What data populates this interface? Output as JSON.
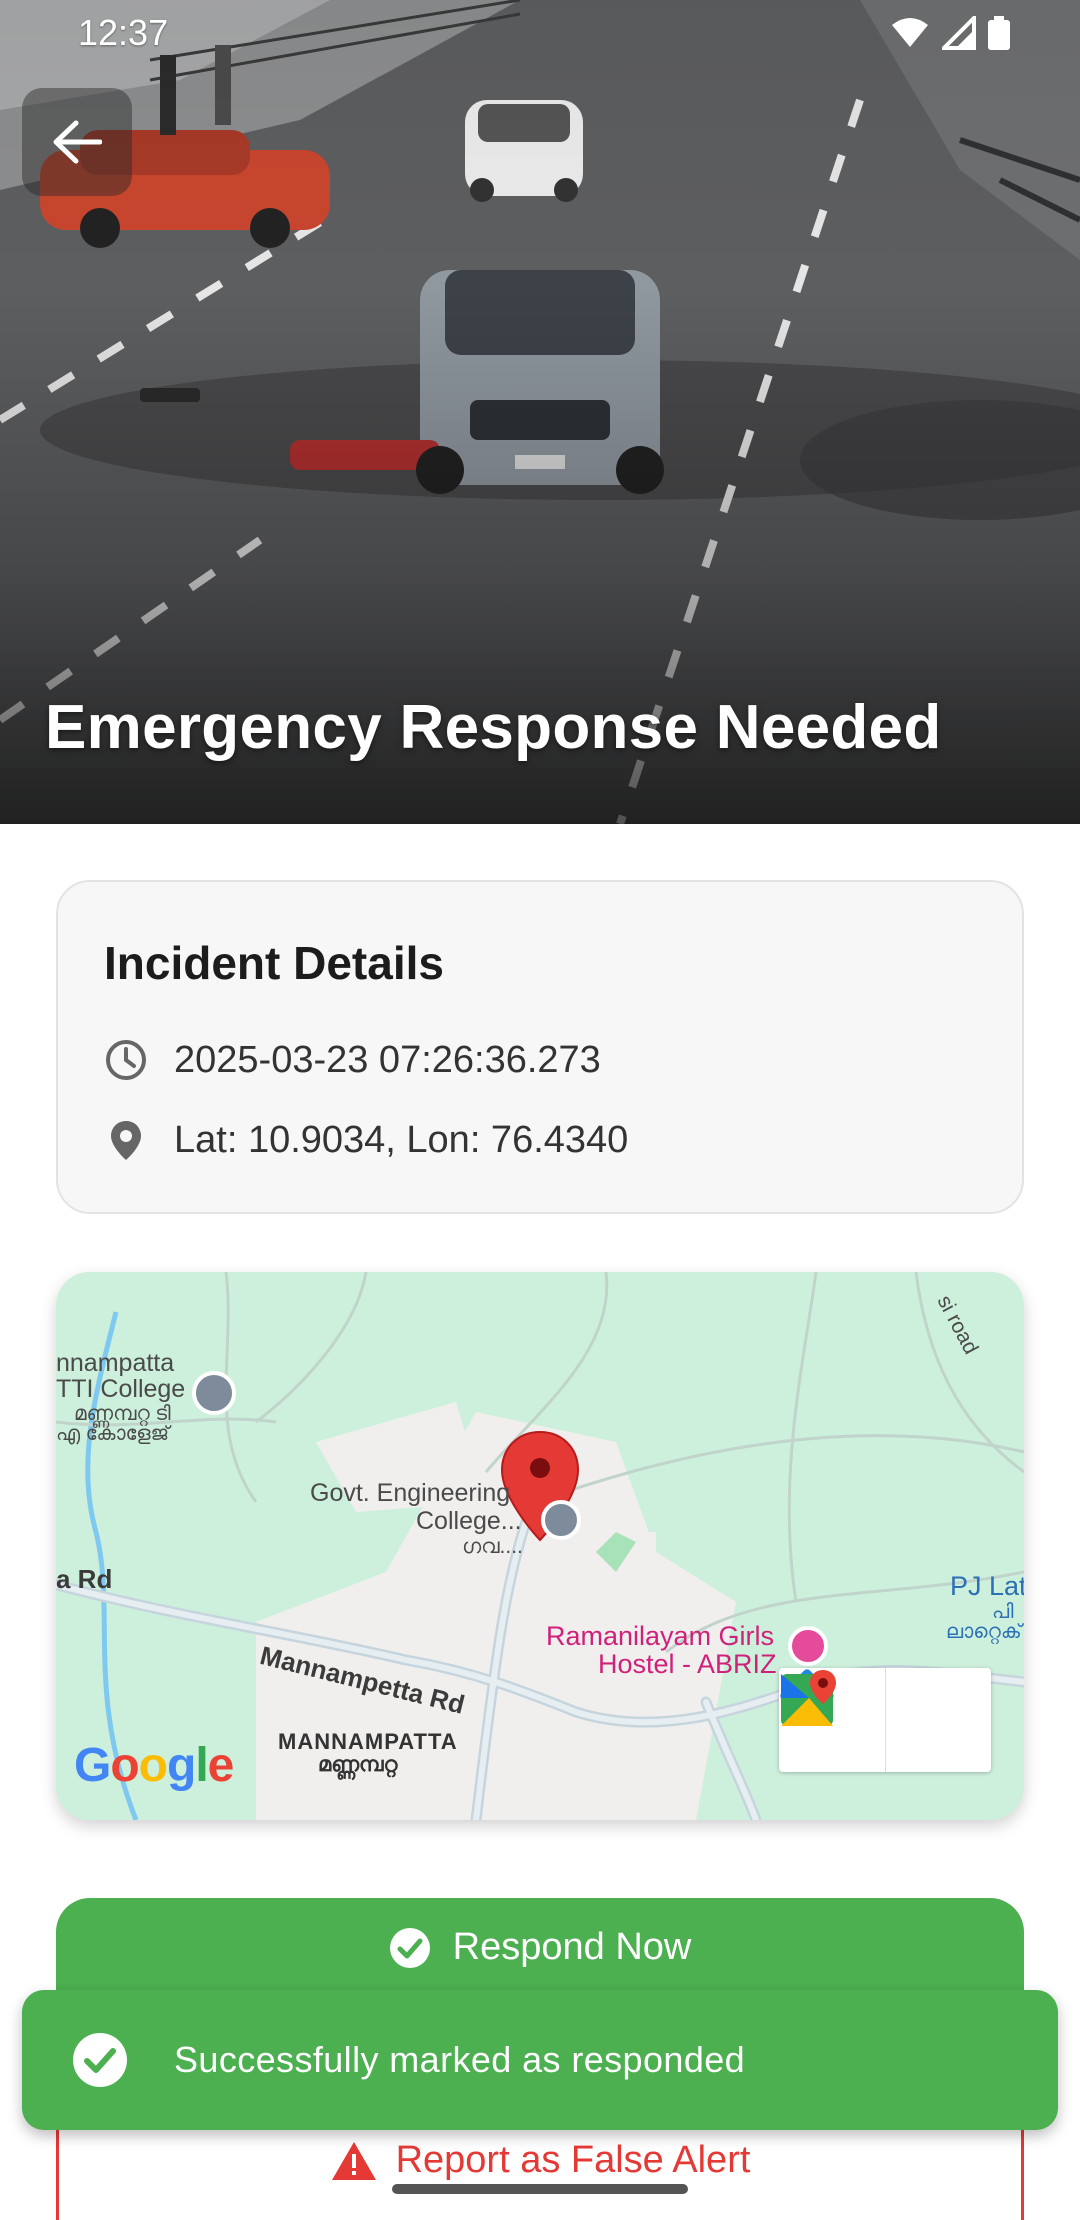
{
  "status_bar": {
    "time": "12:37"
  },
  "hero": {
    "title": "Emergency Response Needed"
  },
  "details": {
    "title": "Incident Details",
    "timestamp": "2025-03-23 07:26:36.273",
    "location": "Lat: 10.9034, Lon: 76.4340"
  },
  "map": {
    "labels": {
      "tti_line1": "nnampatta",
      "tti_line2": "TTI College",
      "tti_ml1": "മണ്ണമ്പറ്റ ടി",
      "tti_ml2": "എ കോളേജ്",
      "govt_line1": "Govt. Engineering",
      "govt_line2": "College...",
      "govt_ml": "ഗവ....",
      "rd_left": "a Rd",
      "mannampetta_rd": "Mannampetta Rd",
      "ramanilayam_line1": "Ramanilayam Girls",
      "ramanilayam_line2": "Hostel - ABRIZ",
      "pj_line1": "PJ Lat",
      "pj_ml1": "പി",
      "pj_ml2": "ലാറ്റെക്",
      "mannampatta": "MANNAMPATTA",
      "mannampatta_ml": "മണ്ണമ്പറ്റ",
      "si_road": "si road"
    },
    "logo": "Google"
  },
  "buttons": {
    "respond": "Respond Now",
    "false_alert": "Report as False Alert"
  },
  "snackbar": {
    "message": "Successfully marked as responded"
  },
  "colors": {
    "success": "#4caf50",
    "danger": "#e53935",
    "map_bg": "#cdf0dc"
  }
}
